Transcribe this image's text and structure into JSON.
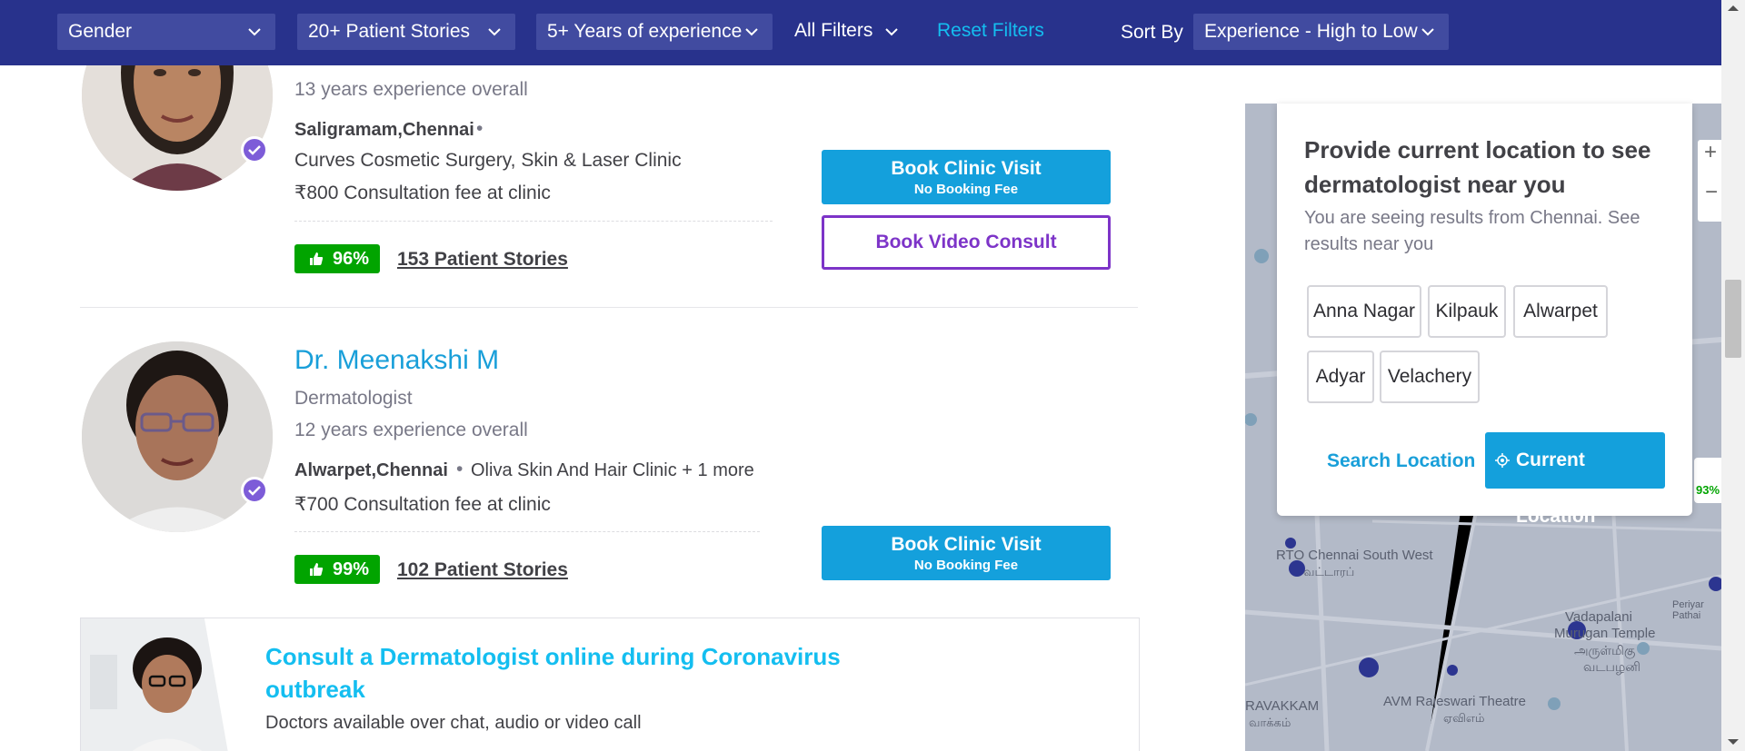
{
  "filters": {
    "gender": "Gender",
    "patient_stories": "20+ Patient Stories",
    "experience": "5+ Years of experience",
    "all_filters": "All Filters",
    "reset": "Reset Filters",
    "sort_by_label": "Sort By",
    "sort_value": "Experience - High to Low"
  },
  "doctors": [
    {
      "experience": "13 years experience overall",
      "location": "Saligramam,Chennai",
      "clinic": "Curves Cosmetic Surgery, Skin & Laser Clinic",
      "fee": "₹800 Consultation fee at clinic",
      "rating": "96%",
      "stories": "153 Patient Stories",
      "book_clinic": "Book Clinic Visit",
      "no_fee": "No Booking Fee",
      "book_video": "Book Video Consult"
    },
    {
      "name": "Dr. Meenakshi M",
      "specialty": "Dermatologist",
      "experience": "12 years experience overall",
      "location": "Alwarpet,Chennai",
      "clinic": "Oliva Skin And Hair Clinic + 1 more",
      "fee": "₹700 Consultation fee at clinic",
      "rating": "99%",
      "stories": "102 Patient Stories",
      "book_clinic": "Book Clinic Visit",
      "no_fee": "No Booking Fee"
    }
  ],
  "banner": {
    "title": "Consult a Dermatologist online during Coronavirus outbreak",
    "subtitle": "Doctors available over chat, audio or video call"
  },
  "location_card": {
    "title": "Provide current location to see dermatologist near you",
    "subtitle": "You are seeing results from Chennai. See results near you",
    "chips": [
      "Anna Nagar",
      "Kilpauk",
      "Alwarpet",
      "Adyar",
      "Velachery"
    ],
    "search_location": "Search Location",
    "current_location": "Current Location"
  },
  "map": {
    "labels": [
      "RTO Chennai South West",
      "வட்டாரப்",
      "Vadapalani",
      "Murugan Temple",
      "அருள்மிகு",
      "வடபழனி",
      "AVM Rajeswari Theatre",
      "ஏவிஎம்",
      "RAVAKKAM",
      "வாக்கம்",
      "Periyar Pathai",
      "93%"
    ],
    "zoom_in": "+",
    "zoom_out": "−"
  },
  "colors": {
    "header": "#28328c",
    "accent": "#14a0dc",
    "video": "#7d34c8",
    "rating": "#01a400"
  }
}
